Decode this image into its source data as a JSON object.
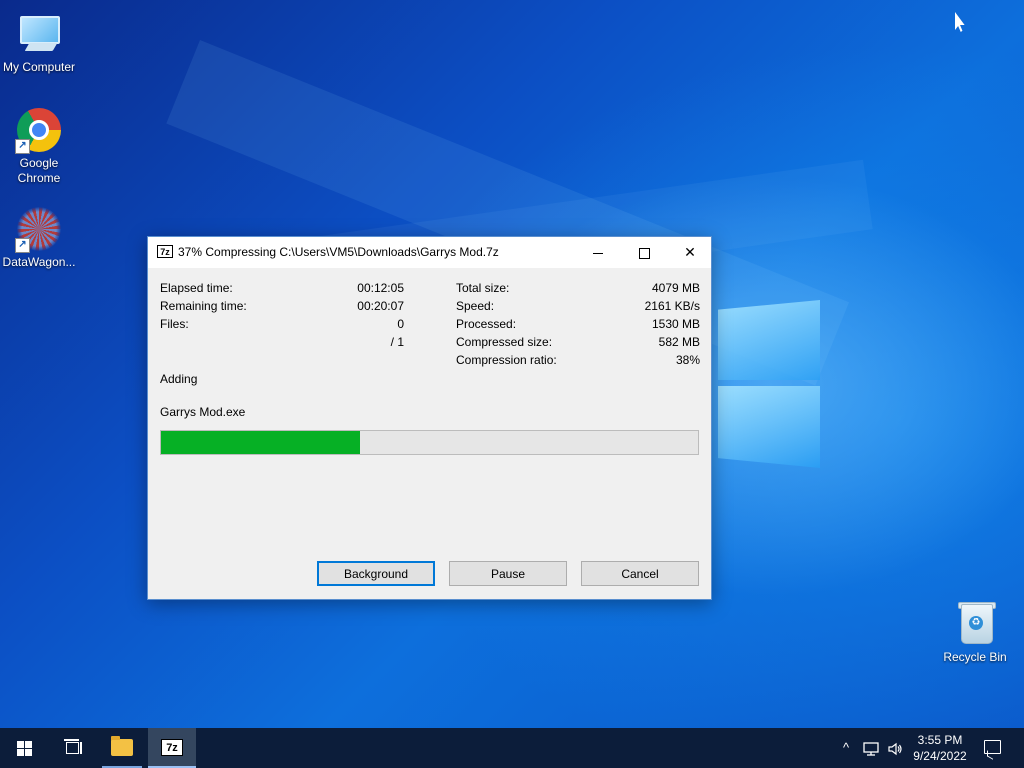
{
  "desktop": {
    "icons": [
      {
        "label": "My Computer"
      },
      {
        "label": "Google Chrome"
      },
      {
        "label": "DataWagon..."
      },
      {
        "label": "Recycle Bin"
      }
    ]
  },
  "dialog": {
    "app_icon": "7z",
    "title": "37% Compressing C:\\Users\\VM5\\Downloads\\Garrys Mod.7z",
    "titlebar_buttons": {
      "minimize": "minimize-icon",
      "maximize": "maximize-icon",
      "close": "✕"
    },
    "left_stats": [
      {
        "label": "Elapsed time:",
        "value": "00:12:05"
      },
      {
        "label": "Remaining time:",
        "value": "00:20:07"
      },
      {
        "label": "Files:",
        "value": "0"
      },
      {
        "label": "",
        "value": "/ 1"
      }
    ],
    "right_stats": [
      {
        "label": "Total size:",
        "value": "4079 MB"
      },
      {
        "label": "Speed:",
        "value": "2161 KB/s"
      },
      {
        "label": "Processed:",
        "value": "1530 MB"
      },
      {
        "label": "Compressed size:",
        "value": "582 MB"
      },
      {
        "label": "Compression ratio:",
        "value": "38%"
      }
    ],
    "action": "Adding",
    "current_file": "Garrys Mod.exe",
    "progress_percent": 37,
    "progress_color": "#06b025",
    "buttons": {
      "background": "Background",
      "pause": "Pause",
      "cancel": "Cancel"
    }
  },
  "taskbar": {
    "start": "windows-start-icon",
    "taskview": "task-view-icon",
    "explorer": "file-explorer-icon",
    "active_app_icon": "7z",
    "tray": {
      "chevron": "^",
      "network": "network-icon",
      "volume": "volume-icon"
    },
    "clock": {
      "time": "3:55 PM",
      "date": "9/24/2022"
    },
    "notifications": "notification-icon"
  }
}
